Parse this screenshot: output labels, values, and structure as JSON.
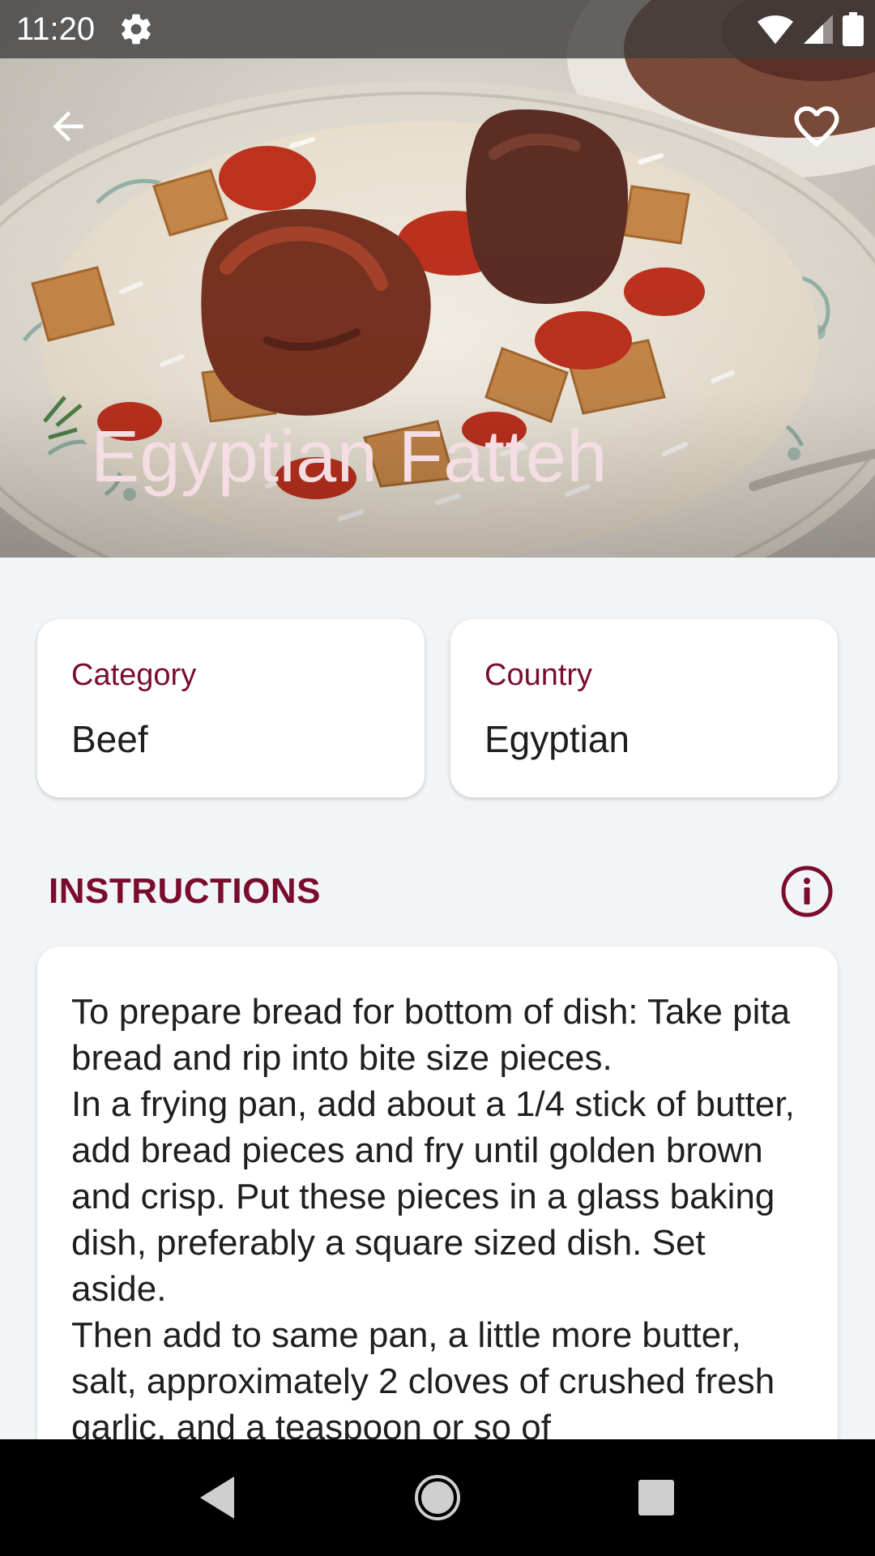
{
  "status_bar": {
    "time": "11:20",
    "icons": [
      "gear-icon",
      "wifi-icon",
      "cell-signal-icon",
      "battery-icon"
    ]
  },
  "app_bar": {
    "back_icon": "arrow-left-icon",
    "favorite_icon": "heart-outline-icon"
  },
  "meal": {
    "name": "Egyptian Fatteh"
  },
  "details": {
    "category_label": "Category",
    "category_value": "Beef",
    "country_label": "Country",
    "country_value": "Egyptian"
  },
  "instructions": {
    "heading": "INSTRUCTIONS",
    "info_icon": "info-circle-icon",
    "text": "To prepare bread for bottom of dish: Take pita bread and rip into bite size pieces.\nIn a frying pan, add about a 1/4 stick of butter, add bread pieces and fry until golden brown and crisp. Put these pieces in a glass baking dish, preferably a square sized dish. Set aside.\nThen add to same pan, a little more butter, salt, approximately 2 cloves of crushed fresh garlic, and a teaspoon or so of"
  },
  "nav_bar": {
    "icons": [
      "nav-back-icon",
      "nav-home-icon",
      "nav-recents-icon"
    ]
  },
  "colors": {
    "accent": "#7a0d2e",
    "background": "#f2f5f7",
    "hero_title": "#f4dde3"
  }
}
